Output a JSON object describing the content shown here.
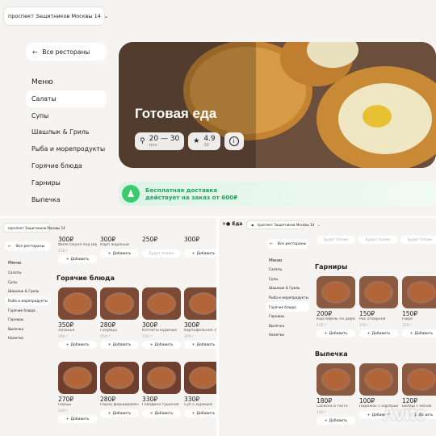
{
  "address": "проспект Защитников Москвы 14",
  "back_label": "Все рестораны",
  "menu_heading": "Меню",
  "menu_items": [
    "Салаты",
    "Супы",
    "Шашлык & Гриль",
    "Рыба и морепродукты",
    "Горячие блюда",
    "Гарниры",
    "Выпечка",
    "Напитки"
  ],
  "hero": {
    "title": "Готовая еда",
    "delivery_time": "20 — 30",
    "delivery_unit": "мин",
    "rating": "4.9",
    "rating_count": "39"
  },
  "promo": {
    "line1": "Бесплатная доставка",
    "line2": "действует на заказ от 600₽"
  },
  "left_top_row": [
    {
      "price": "300₽",
      "name": "Филе Окуня под маринадом",
      "weight": "150 г",
      "btn": "Добавить",
      "enabled": true
    },
    {
      "price": "300₽",
      "name": "Карп жареный",
      "weight": "",
      "btn": "Добавить",
      "enabled": true
    },
    {
      "price": "250₽",
      "name": "",
      "weight": "",
      "btn": "Будет позже",
      "enabled": false
    },
    {
      "price": "300₽",
      "name": "",
      "weight": "",
      "btn": "Добавить",
      "enabled": true
    }
  ],
  "hot_title": "Горячие блюда",
  "hot_row1": [
    {
      "price": "350₽",
      "name": "Лазанья",
      "weight": "200 г",
      "btn": "Добавить"
    },
    {
      "price": "280₽",
      "name": "Голубцы",
      "weight": "250 г",
      "btn": "Добавить"
    },
    {
      "price": "300₽",
      "name": "Котлеты куриные",
      "weight": "150 г",
      "btn": "Добавить"
    },
    {
      "price": "300₽",
      "name": "Картофельная Запеканка",
      "weight": "200 г",
      "btn": "Добавить"
    }
  ],
  "hot_row2": [
    {
      "price": "270₽",
      "name": "Перцы",
      "weight": "200 г",
      "btn": "Добавить"
    },
    {
      "price": "280₽",
      "name": "Перец фаршированный",
      "weight": "",
      "btn": "Добавить"
    },
    {
      "price": "330₽",
      "name": "Говядина тушеная",
      "weight": "",
      "btn": "Добавить"
    },
    {
      "price": "330₽",
      "name": "Суп с курицей",
      "weight": "",
      "btn": "Добавить"
    }
  ],
  "logo_text": "Еда",
  "right_strip": [
    "Будет позже",
    "Будет позже",
    "Будет позже"
  ],
  "garnish_title": "Гарниры",
  "garnish": [
    {
      "price": "200₽",
      "name": "Картофель по деревенски",
      "weight": "150 г",
      "btn": "Добавить"
    },
    {
      "price": "150₽",
      "name": "Рис отварной",
      "weight": "150 г",
      "btn": "Добавить"
    },
    {
      "price": "150₽",
      "name": "Пюре",
      "weight": "150 г",
      "btn": "Добавить"
    }
  ],
  "bakery_title": "Выпечка",
  "bakery": [
    {
      "price": "180₽",
      "name": "Сосиска в тесте",
      "weight": "140 г",
      "btn": "Добавить"
    },
    {
      "price": "100₽",
      "name": "Пирожок с картошкой",
      "weight": "",
      "btn": "Добавить"
    },
    {
      "price": "120₽",
      "name": "Беляш с мясом",
      "weight": "",
      "btn": "Добавить"
    }
  ],
  "watermark": "Avito"
}
